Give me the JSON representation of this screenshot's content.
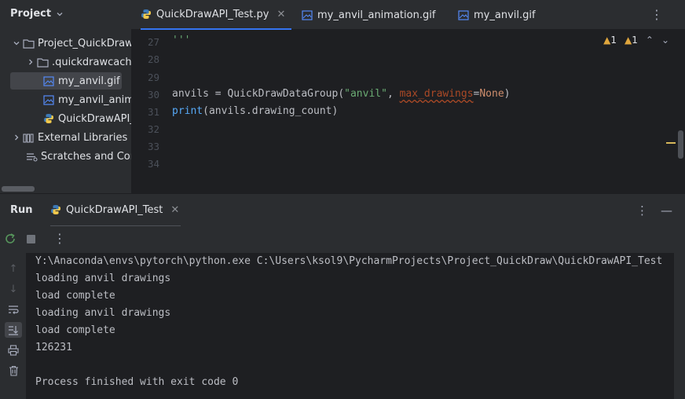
{
  "project": {
    "title": "Project",
    "items": [
      {
        "label": "Project_QuickDraw",
        "type": "folder",
        "expanded": true
      },
      {
        "label": ".quickdrawcache",
        "type": "folder",
        "expanded": false
      },
      {
        "label": "my_anvil.gif",
        "type": "image",
        "selected": true
      },
      {
        "label": "my_anvil_animation.gif",
        "type": "image"
      },
      {
        "label": "QuickDrawAPI_Test.py",
        "type": "python"
      },
      {
        "label": "External Libraries",
        "type": "library",
        "expanded": false
      },
      {
        "label": "Scratches and Consoles",
        "type": "scratches"
      }
    ]
  },
  "editor": {
    "tabs": [
      {
        "label": "QuickDrawAPI_Test.py",
        "icon": "python-icon",
        "active": true,
        "closable": true
      },
      {
        "label": "my_anvil_animation.gif",
        "icon": "image-icon",
        "active": false
      },
      {
        "label": "my_anvil.gif",
        "icon": "image-icon",
        "active": false
      }
    ],
    "inspections": {
      "warnings_a": "1",
      "warnings_b": "1"
    },
    "lines": [
      {
        "num": "27",
        "code": "'''"
      },
      {
        "num": "28",
        "code": ""
      },
      {
        "num": "29",
        "code": ""
      },
      {
        "num": "30",
        "code": "anvils = QuickDrawDataGroup(\"anvil\", max_drawings=None)"
      },
      {
        "num": "31",
        "code": "print(anvils.drawing_count)"
      },
      {
        "num": "32",
        "code": ""
      },
      {
        "num": "33",
        "code": ""
      },
      {
        "num": "34",
        "code": ""
      }
    ],
    "line30": {
      "var": "anvils = QuickDrawDataGroup(",
      "str": "\"anvil\"",
      "comma": ", ",
      "named": "max_drawings",
      "eq": "=",
      "kw": "None",
      "close": ")"
    },
    "line31": {
      "fn": "print",
      "rest": "(anvils.drawing_count)"
    }
  },
  "run": {
    "title": "Run",
    "tab_label": "QuickDrawAPI_Test",
    "console": [
      "Y:\\Anaconda\\envs\\pytorch\\python.exe C:\\Users\\ksol9\\PycharmProjects\\Project_QuickDraw\\QuickDrawAPI_Test",
      "loading anvil drawings",
      "load complete",
      "loading anvil drawings",
      "load complete",
      "126231",
      "",
      "Process finished with exit code 0"
    ]
  },
  "colors": {
    "accent": "#3574f0",
    "panel": "#2b2d30",
    "background": "#1e1f22",
    "string": "#6aab73",
    "keyword": "#cf8e6d",
    "function": "#56a8f5",
    "warning": "#e0a63d"
  }
}
